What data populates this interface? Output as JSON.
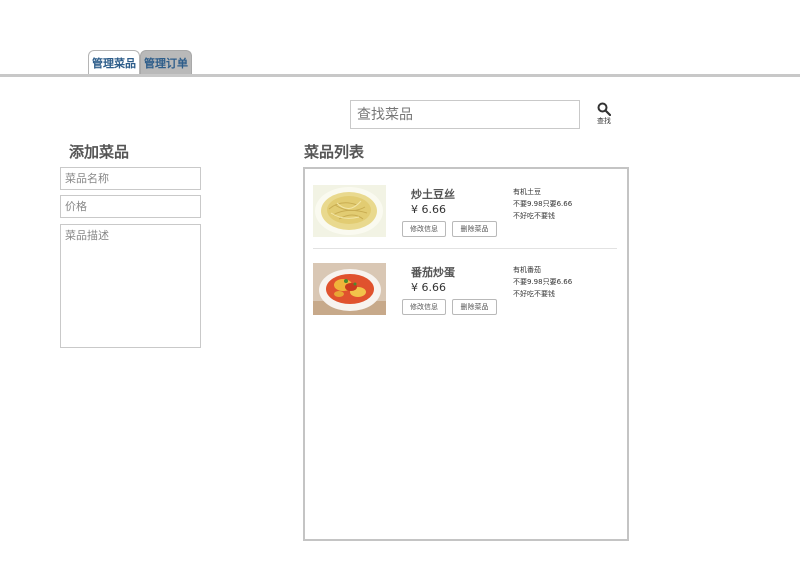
{
  "tabs": [
    {
      "label": "管理菜品",
      "active": true
    },
    {
      "label": "管理订单",
      "active": false
    }
  ],
  "search": {
    "placeholder": "查找菜品",
    "button_label": "查找"
  },
  "add_section": {
    "title": "添加菜品",
    "name_placeholder": "菜品名称",
    "price_placeholder": "价格",
    "desc_placeholder": "菜品描述"
  },
  "list_section": {
    "title": "菜品列表",
    "dishes": [
      {
        "name": "炒土豆丝",
        "price": "¥ 6.66",
        "edit_label": "修改信息",
        "delete_label": "删除菜品",
        "desc": [
          "有机土豆",
          "不要9.98只要6.66",
          "不好吃不要钱"
        ]
      },
      {
        "name": "番茄炒蛋",
        "price": "¥ 6.66",
        "edit_label": "修改信息",
        "delete_label": "删除菜品",
        "desc": [
          "有机番茄",
          "不要9.98只要6.66",
          "不好吃不要钱"
        ]
      }
    ]
  },
  "colors": {
    "tab_text": "#2d5d8a",
    "tab_inactive_bg": "#b9b9b9",
    "border": "#c9c9c9"
  }
}
